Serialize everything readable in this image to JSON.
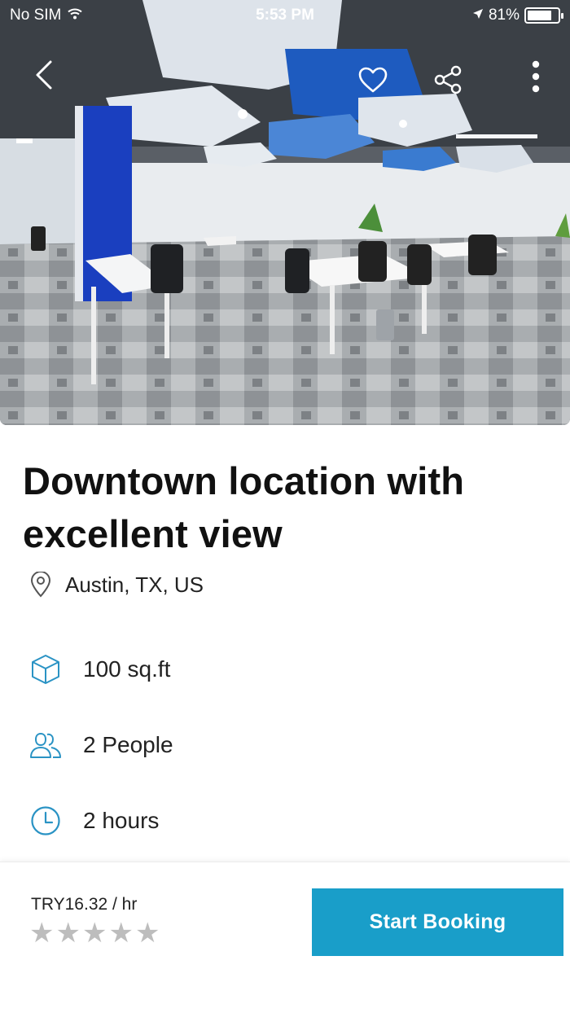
{
  "status_bar": {
    "carrier": "No SIM",
    "time": "5:53 PM",
    "battery_percent": "81%",
    "battery_level": 0.81
  },
  "header": {
    "icons": [
      "back-chevron-icon",
      "heart-icon",
      "share-icon",
      "more-vertical-icon"
    ]
  },
  "listing": {
    "title": "Downtown location with excellent view",
    "location": "Austin, TX, US",
    "features": [
      {
        "icon": "cube-icon",
        "label": "100 sq.ft"
      },
      {
        "icon": "people-icon",
        "label": "2 People"
      },
      {
        "icon": "clock-icon",
        "label": "2 hours"
      }
    ]
  },
  "footer": {
    "price": "TRY16.32 / hr",
    "rating": 0,
    "rating_max": 5,
    "book_label": "Start Booking"
  },
  "colors": {
    "accent": "#199ec9",
    "icon_outline": "#2a93c4",
    "star_empty": "#bdbdbd"
  }
}
